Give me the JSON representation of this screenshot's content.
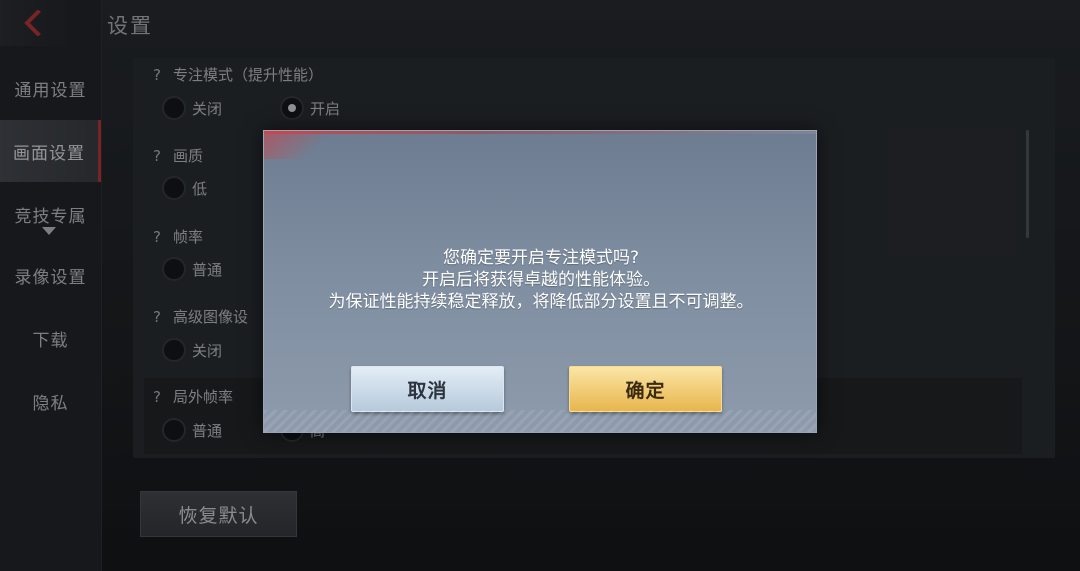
{
  "header": {
    "title": "设置"
  },
  "sidebar": {
    "items": [
      {
        "label": "通用设置",
        "active": false
      },
      {
        "label": "画面设置",
        "active": true
      },
      {
        "label": "竞技专属",
        "active": false
      },
      {
        "label": "录像设置",
        "active": false
      },
      {
        "label": "下载",
        "active": false
      },
      {
        "label": "隐私",
        "active": false
      }
    ]
  },
  "settings": [
    {
      "label": "专注模式（提升性能）",
      "options": [
        "关闭",
        "开启"
      ],
      "selected": "开启"
    },
    {
      "label": "画质",
      "options": [
        "低"
      ]
    },
    {
      "label": "帧率",
      "options": [
        "普通"
      ]
    },
    {
      "label": "高级图像设",
      "options": [
        "关闭"
      ]
    },
    {
      "label": "局外帧率",
      "options": [
        "普通",
        "高"
      ]
    }
  ],
  "footer": {
    "reset_label": "恢复默认"
  },
  "dialog": {
    "line1": "您确定要开启专注模式吗?",
    "line2": "开启后将获得卓越的性能体验。",
    "line3": "为保证性能持续稳定释放，将降低部分设置且不可调整。",
    "cancel_label": "取消",
    "confirm_label": "确定"
  },
  "colors": {
    "active_indicator": "#c23a3a",
    "confirm_button": "#e8b54d",
    "cancel_button": "#b7cadb"
  },
  "icons": {
    "back": "chevron-left-icon",
    "help": "question-mark-icon",
    "expand": "caret-down-icon"
  }
}
